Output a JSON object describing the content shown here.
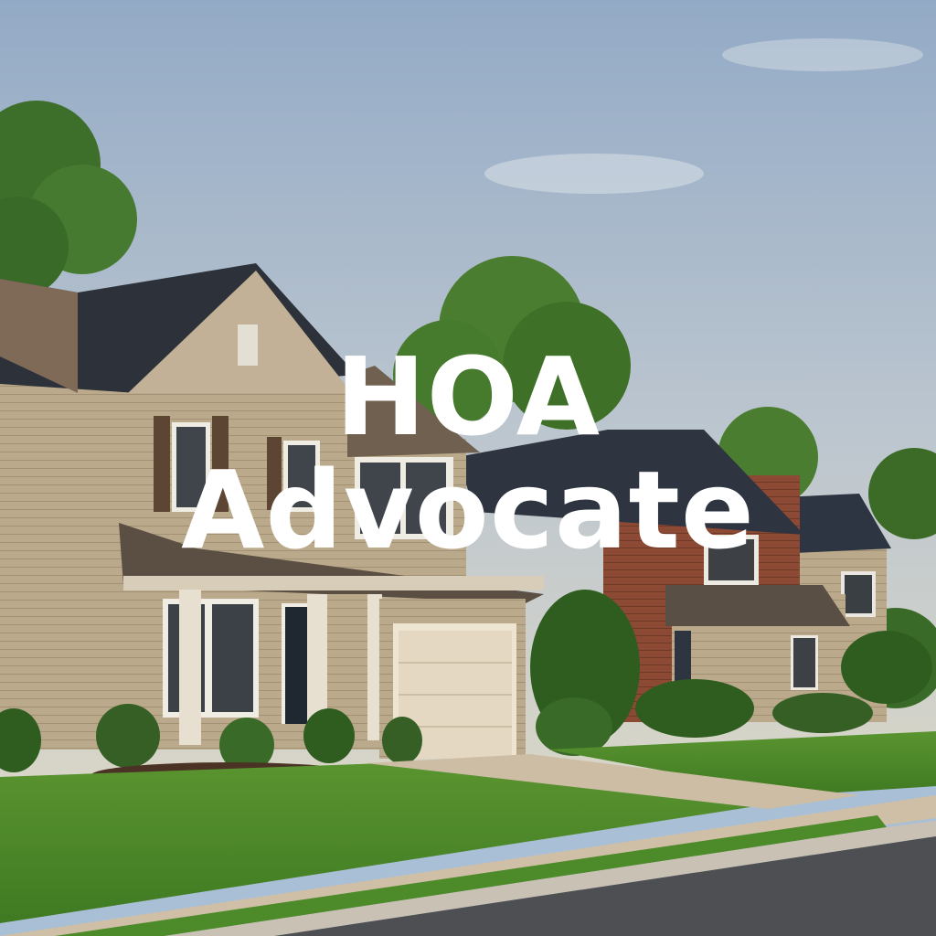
{
  "banner": {
    "title_line_1": "HOA",
    "title_line_2": "Advocate"
  },
  "colors": {
    "sky_top": "#93aac6",
    "sky_bottom": "#d3d6cf",
    "lawn": "#4e8a2a",
    "siding": "#bfae92",
    "roof": "#2f3540",
    "brick": "#8e4a36",
    "text": "#ffffff"
  }
}
